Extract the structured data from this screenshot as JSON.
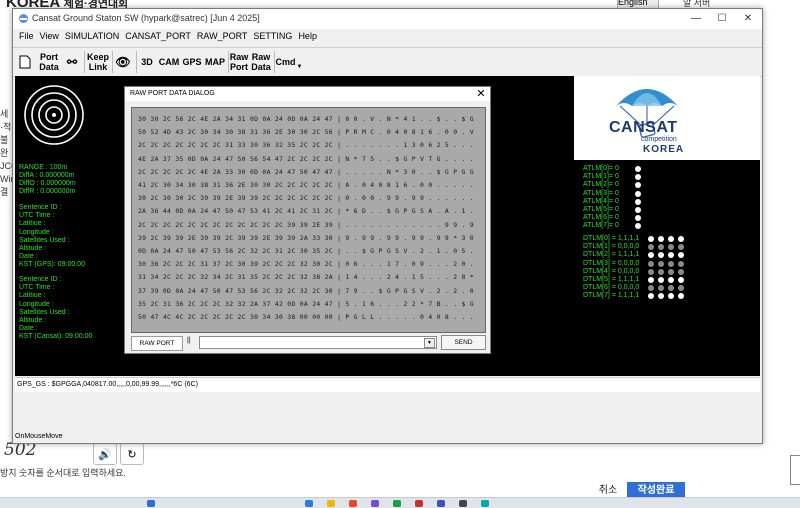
{
  "background": {
    "title": "KOREA",
    "title_suffix": "체험·경연대회",
    "left_fragments": [
      "세오",
      "·적",
      "불예",
      "완두",
      "JCC",
      "Win",
      "결과"
    ],
    "captcha": "502",
    "caption": "방지 숫자를 순서대로 입력하세요.",
    "cancel_label": "취소",
    "done_label": "작성완료",
    "tab_label": "English",
    "right_text": "알 서버"
  },
  "window": {
    "title": "Cansat Ground Staton SW (hypark@satrec) [Jun  4 2025]",
    "controls": [
      "—",
      "☐",
      "✕"
    ]
  },
  "menu": [
    "File",
    "View",
    "SIMULATION",
    "CANSAT_PORT",
    "RAW_PORT",
    "SETTING",
    "Help"
  ],
  "toolbar": {
    "port_data": [
      "Port",
      "Data"
    ],
    "keep_link": [
      "Keep",
      "Link"
    ],
    "labels": [
      "3D",
      "CAM",
      "GPS",
      "MAP"
    ],
    "raw_port": [
      "Raw",
      "Port"
    ],
    "raw_data": [
      "Raw",
      "Data"
    ],
    "cmd": "Cmd"
  },
  "gps_info": {
    "range": "RANGE : 100m",
    "diffs": [
      "DiffA : 0.000000m",
      "DiffO : 0.000000m",
      "DiffR : 0.000000m"
    ],
    "gps_block": [
      "Sentence ID :",
      "UTC Time :",
      "Latitiue :",
      "Longitude :",
      "Satellites Used :",
      "Altitude :",
      "Date :",
      "KST (GPS): 09:00:00"
    ],
    "cansat_block": [
      "Sentence ID :",
      "UTC Time :",
      "Latitiue :",
      "Longitude :",
      "Satellites Used :",
      "Altitude :",
      "Date :",
      "KST (Cansat): 09:00:00"
    ]
  },
  "atlm": [
    {
      "label": "ATLM[0]=",
      "value": "0"
    },
    {
      "label": "ATLM[1]=",
      "value": "0"
    },
    {
      "label": "ATLM[2]=",
      "value": "0"
    },
    {
      "label": "ATLM[3]=",
      "value": "0"
    },
    {
      "label": "ATLM[4]=",
      "value": "0"
    },
    {
      "label": "ATLM[5]=",
      "value": "0"
    },
    {
      "label": "ATLM[6]=",
      "value": "0"
    },
    {
      "label": "ATLM[7]=",
      "value": "0"
    }
  ],
  "dtlm": [
    {
      "label": "DTLM[0] =",
      "value": "1,1,1,1",
      "dots": [
        "w",
        "w",
        "w",
        "w"
      ]
    },
    {
      "label": "DTLM[1] =",
      "value": "0,0,0,0",
      "dots": [
        "g",
        "g",
        "g",
        "g"
      ]
    },
    {
      "label": "DTLM[2] =",
      "value": "1,1,1,1",
      "dots": [
        "w",
        "w",
        "w",
        "w"
      ]
    },
    {
      "label": "DTLM[3] =",
      "value": "0,0,0,0",
      "dots": [
        "g",
        "g",
        "g",
        "g"
      ]
    },
    {
      "label": "DTLM[4] =",
      "value": "0,0,0,0",
      "dots": [
        "g",
        "g",
        "g",
        "g"
      ]
    },
    {
      "label": "DTLM[5] =",
      "value": "1,1,1,1",
      "dots": [
        "w",
        "w",
        "w",
        "w"
      ]
    },
    {
      "label": "DTLM[6] =",
      "value": "0,0,0,0",
      "dots": [
        "g",
        "g",
        "g",
        "g"
      ]
    },
    {
      "label": "DTLM[7] =",
      "value": "1,1,1,1",
      "dots": [
        "w",
        "w",
        "w",
        "w"
      ]
    }
  ],
  "logo": {
    "main": "CANSAT",
    "sub": "competition",
    "country": "KOREA"
  },
  "status_line": "GPS_GS : $GPGGA,040817.00,,,,,0,00,99.99,,,,,,*6C (6C)",
  "bottom_status": "OnMouseMove",
  "dialog": {
    "title": "RAW PORT DATA DIALOG",
    "close": "✕",
    "hex_lines": [
      "30 30 2C 56 2C 4E 2A 34 31 0D 0A 24 0D 0A 24 47 | 0 0 . V . N * 4 1 . . $ . . $ G",
      "50 52 4D 43 2C 30 34 30 38 31 36 2E 30 30 2C 56 | P R M C . 0 4 0 8 1 6 . 0 0 . V",
      "2C 2C 2C 2C 2C 2C 2C 31 33 30 36 32 35 2C 2C 2C | . . . . . . . 1 3 0 6 2 5 . . .",
      "4E 2A 37 35 0D 0A 24 47 50 56 54 47 2C 2C 2C 2C | N * 7 5 . . $ G P V T G . . . .",
      "2C 2C 2C 2C 2C 4E 2A 33 30 0D 0A 24 47 50 47 47 | . . . . . N * 3 0 . . $ G P G G",
      "41 2C 30 34 30 38 31 36 2E 30 30 2C 2C 2C 2C 2C | A . 0 4 0 8 1 6 . 0 0 . . . . .",
      "30 2C 30 30 2C 39 39 2E 39 39 2C 2C 2C 2C 2C 2C | 0 . 0 0 . 9 9 . 9 9 . . . . . .",
      "2A 36 44 0D 0A 24 47 50 47 53 41 2C 41 2C 31 2C | * 6 D . . $ G P G S A . A . 1 .",
      "2C 2C 2C 2C 2C 2C 2C 2C 2C 2C 2C 2C 39 39 2E 39 | . . . . . . . . . . . . 9 9 . 9",
      "39 2C 39 39 2E 39 39 2C 39 39 2E 39 39 2A 33 30 | 9 . 9 9 . 9 9 . 9 9 . 9 9 * 3 0",
      "0D 0A 24 47 50 47 53 56 2C 32 2C 31 2C 30 35 2C | . . $ G P G S V . 2 . 1 . 0 5 .",
      "30 36 2C 2C 2C 31 37 2C 30 39 2C 2C 2C 32 30 2C | 0 6 . . . 1 7 . 0 9 . . . 2 0 .",
      "31 34 2C 2C 2C 32 34 2C 31 35 2C 2C 2C 32 38 2A | 1 4 . . . 2 4 . 1 5 . . . 2 8 *",
      "37 39 0D 0A 24 47 50 47 53 56 2C 32 2C 32 2C 30 | 7 9 . . $ G P G S V . 2 . 2 . 0",
      "35 2C 31 36 2C 2C 2C 32 32 2A 37 42 0D 0A 24 47 | 5 . 1 6 . . . 2 2 * 7 B . . $ G",
      "50 47 4C 4C 2C 2C 2C 2C 2C 30 34 30 38 00 00 00 | P G L L . . . . . 0 4 0 8 . . ."
    ],
    "rawport_label": "RAW PORT",
    "pipe": "||",
    "send_label": "SEND",
    "cmd_value": ""
  },
  "colors": {
    "display_bg": "#000000",
    "telemetry_green": "#2be02b",
    "hex_bg": "#a9a9a9",
    "logo_blue": "#1d3a72",
    "accent_blue": "#2f6fd6"
  }
}
